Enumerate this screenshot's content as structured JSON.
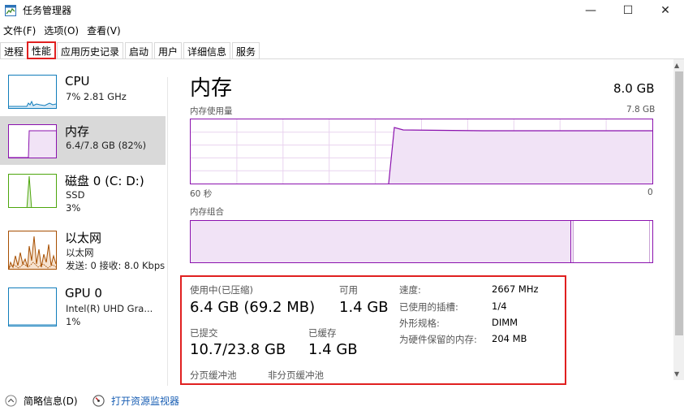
{
  "window": {
    "title": "任务管理器",
    "minimize_glyph": "—",
    "maximize_glyph": "☐",
    "close_glyph": "✕"
  },
  "menu": [
    "文件(F)",
    "选项(O)",
    "查看(V)"
  ],
  "tabs": [
    {
      "label": "进程",
      "active": false
    },
    {
      "label": "性能",
      "active": true
    },
    {
      "label": "应用历史记录",
      "active": false
    },
    {
      "label": "启动",
      "active": false
    },
    {
      "label": "用户",
      "active": false
    },
    {
      "label": "详细信息",
      "active": false
    },
    {
      "label": "服务",
      "active": false
    }
  ],
  "sidebar": [
    {
      "title": "CPU",
      "sub1": "7% 2.81 GHz",
      "sub2": "",
      "sub3": "",
      "color": "#117dbb",
      "icon": "cpu-thumbnail"
    },
    {
      "title": "内存",
      "sub1": "6.4/7.8 GB (82%)",
      "sub2": "",
      "sub3": "",
      "color": "#8b12ae",
      "icon": "memory-thumbnail"
    },
    {
      "title": "磁盘 0 (C: D:)",
      "sub1": "SSD",
      "sub2": "3%",
      "sub3": "",
      "color": "#4da60c",
      "icon": "disk-thumbnail"
    },
    {
      "title": "以太网",
      "sub1": "以太网",
      "sub2": "发送: 0 接收: 8.0 Kbps",
      "sub3": "",
      "color": "#a74f01",
      "icon": "ethernet-thumbnail"
    },
    {
      "title": "GPU 0",
      "sub1": "Intel(R) UHD Gra...",
      "sub2": "1%",
      "sub3": "",
      "color": "#117dbb",
      "icon": "gpu-thumbnail"
    }
  ],
  "main": {
    "title": "内存",
    "total": "8.0 GB",
    "usage_caption": "内存使用量",
    "usage_max": "7.8 GB",
    "time_left": "60 秒",
    "time_right": "0",
    "composition_caption": "内存组合",
    "accent": "#8b12ae",
    "usage_fraction": 0.82
  },
  "stats": {
    "in_use_label": "使用中(已压缩)",
    "in_use_value": "6.4 GB (69.2 MB)",
    "available_label": "可用",
    "available_value": "1.4 GB",
    "committed_label": "已提交",
    "committed_value": "10.7/23.8 GB",
    "cached_label": "已缓存",
    "cached_value": "1.4 GB",
    "paged_pool_label": "分页缓冲池",
    "nonpaged_pool_label": "非分页缓冲池",
    "details": [
      {
        "key": "速度:",
        "value": "2667 MHz"
      },
      {
        "key": "已使用的插槽:",
        "value": "1/4"
      },
      {
        "key": "外形规格:",
        "value": "DIMM"
      },
      {
        "key": "为硬件保留的内存:",
        "value": "204 MB"
      }
    ]
  },
  "footer": {
    "summary_label": "简略信息(D)",
    "resource_monitor_label": "打开资源监视器"
  }
}
